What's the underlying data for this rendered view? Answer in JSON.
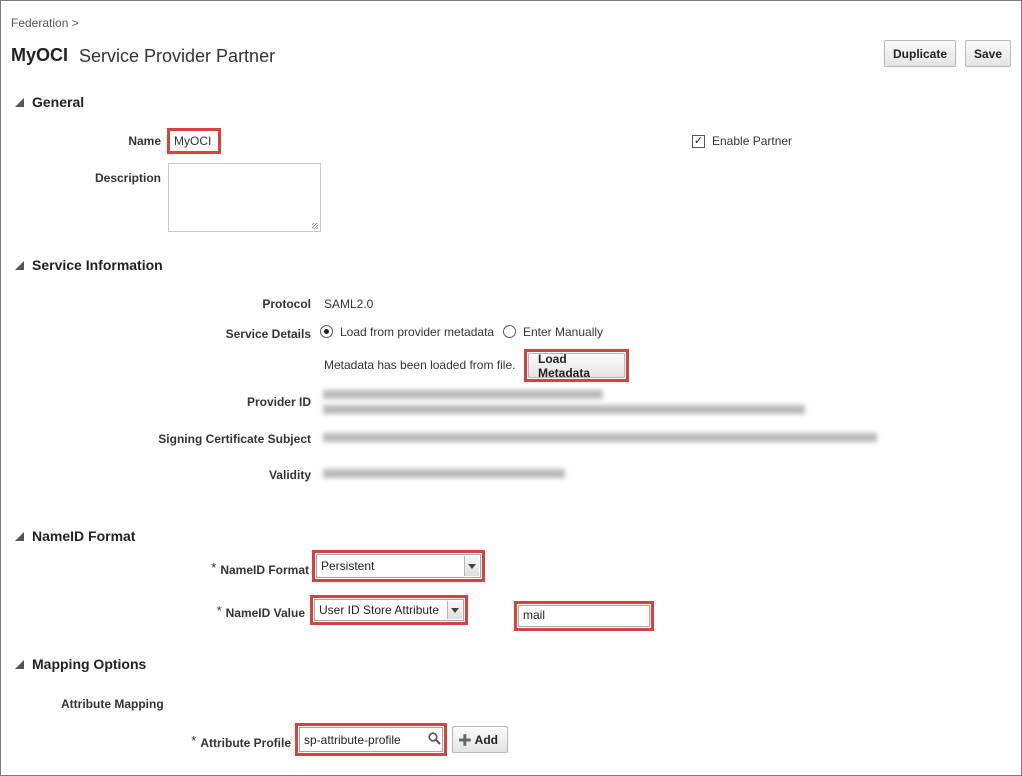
{
  "breadcrumb": "Federation >",
  "header": {
    "title": "MyOCI",
    "subtitle": "Service Provider Partner",
    "duplicate_label": "Duplicate",
    "save_label": "Save"
  },
  "general": {
    "heading": "General",
    "name_label": "Name",
    "name_value": "MyOCI",
    "description_label": "Description",
    "description_value": "",
    "enable_partner_label": "Enable Partner",
    "enable_partner_checked": true
  },
  "service": {
    "heading": "Service Information",
    "protocol_label": "Protocol",
    "protocol_value": "SAML2.0",
    "details_label": "Service Details",
    "option_metadata": "Load from provider metadata",
    "option_manual": "Enter Manually",
    "selected_option": "Load from provider metadata",
    "metadata_status": "Metadata has been loaded from file.",
    "load_metadata_label": "Load Metadata",
    "provider_id_label": "Provider ID",
    "signing_cert_label": "Signing Certificate Subject",
    "validity_label": "Validity"
  },
  "nameid": {
    "heading": "NameID Format",
    "format_label": "NameID Format",
    "format_value": "Persistent",
    "value_label": "NameID Value",
    "value_select": "User ID Store Attribute",
    "value_attribute": "mail",
    "required_mark": "*"
  },
  "mapping": {
    "heading": "Mapping Options",
    "subheading": "Attribute Mapping",
    "profile_label": "Attribute Profile",
    "profile_value": "sp-attribute-profile",
    "add_label": "Add",
    "required_mark": "*"
  },
  "colors": {
    "highlight": "#d9403f",
    "text": "#333333"
  },
  "icons": {
    "collapse": "triangle-down",
    "search": "magnifier",
    "add": "plus"
  }
}
